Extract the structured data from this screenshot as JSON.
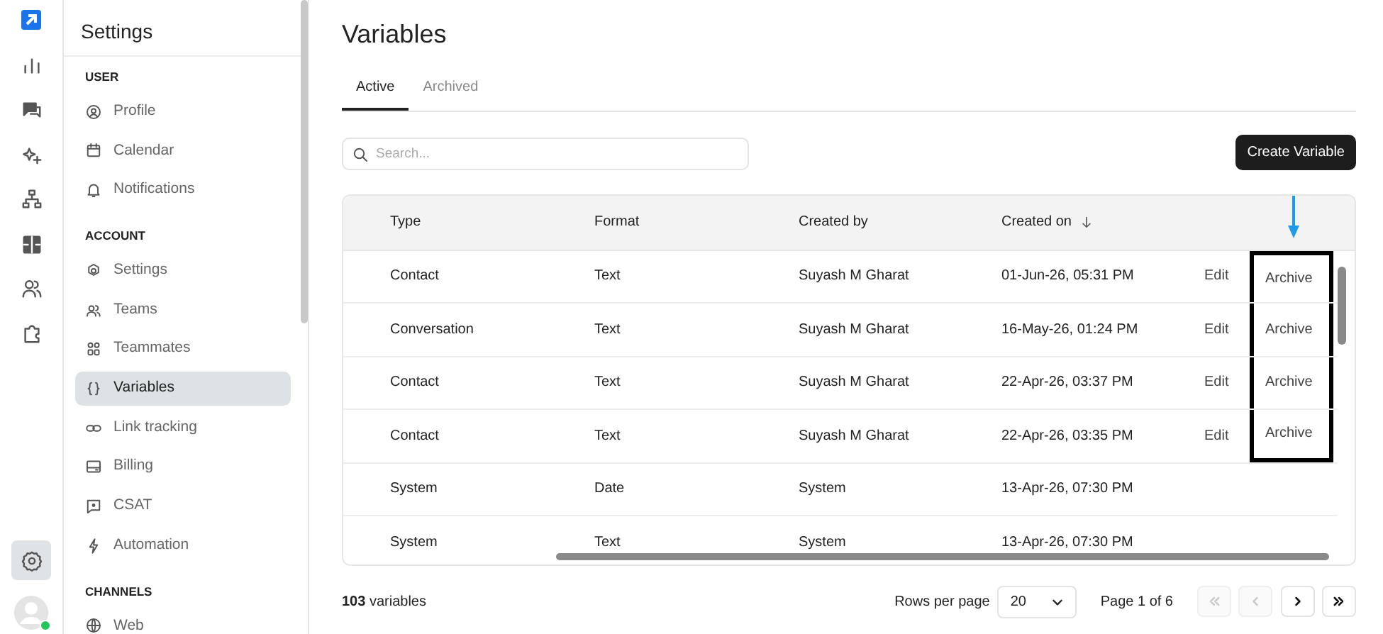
{
  "rail": {
    "items": [
      {
        "selected": false
      },
      {
        "selected": false
      },
      {
        "selected": false
      },
      {
        "selected": false
      },
      {
        "selected": false
      },
      {
        "selected": false
      },
      {
        "selected": false
      }
    ],
    "settings_selected": true,
    "user_online": true
  },
  "sidebar": {
    "title": "Settings",
    "sections": [
      {
        "heading": "USER",
        "items": [
          {
            "label": "Profile",
            "selected": false
          },
          {
            "label": "Calendar",
            "selected": false
          },
          {
            "label": "Notifications",
            "selected": false
          }
        ]
      },
      {
        "heading": "ACCOUNT",
        "items": [
          {
            "label": "Settings",
            "selected": false
          },
          {
            "label": "Teams",
            "selected": false
          },
          {
            "label": "Teammates",
            "selected": false
          },
          {
            "label": "Variables",
            "selected": true
          },
          {
            "label": "Link tracking",
            "selected": false
          },
          {
            "label": "Billing",
            "selected": false
          },
          {
            "label": "CSAT",
            "selected": false
          },
          {
            "label": "Automation",
            "selected": false
          }
        ]
      },
      {
        "heading": "CHANNELS",
        "items": [
          {
            "label": "Web",
            "selected": false
          }
        ]
      }
    ]
  },
  "page": {
    "title": "Variables",
    "tabs": [
      {
        "label": "Active",
        "selected": true
      },
      {
        "label": "Archived",
        "selected": false
      }
    ],
    "search": {
      "placeholder": "Search..."
    },
    "create_button": "Create Variable",
    "table": {
      "columns": [
        {
          "label": "Type",
          "sorted": false
        },
        {
          "label": "Format",
          "sorted": false
        },
        {
          "label": "Created by",
          "sorted": false
        },
        {
          "label": "Created on",
          "sorted": true
        }
      ],
      "rows": [
        {
          "type": "Contact",
          "format": "Text",
          "created_by": "Suyash M Gharat",
          "created_on": "01-Jun-26, 05:31 PM",
          "actions": [
            "Edit",
            "Archive"
          ],
          "highlighted": true
        },
        {
          "type": "Conversation",
          "format": "Text",
          "created_by": "Suyash M Gharat",
          "created_on": "16-May-26, 01:24 PM",
          "actions": [
            "Edit",
            "Archive"
          ],
          "highlighted": true
        },
        {
          "type": "Contact",
          "format": "Text",
          "created_by": "Suyash M Gharat",
          "created_on": "22-Apr-26, 03:37 PM",
          "actions": [
            "Edit",
            "Archive"
          ],
          "highlighted": true
        },
        {
          "type": "Contact",
          "format": "Text",
          "created_by": "Suyash M Gharat",
          "created_on": "22-Apr-26, 03:35 PM",
          "actions": [
            "Edit",
            "Archive"
          ],
          "highlighted": true
        },
        {
          "type": "System",
          "format": "Date",
          "created_by": "System",
          "created_on": "13-Apr-26, 07:30 PM",
          "actions": [],
          "highlighted": false
        },
        {
          "type": "System",
          "format": "Text",
          "created_by": "System",
          "created_on": "13-Apr-26, 07:30 PM",
          "actions": [],
          "highlighted": false
        }
      ]
    },
    "footer": {
      "count": "**103** variables",
      "rows_per_page_label": "Rows per page",
      "rows_per_page": "20",
      "page_info": "Page 1 of 6",
      "pager": [
        {
          "disabled": true
        },
        {
          "disabled": true
        },
        {
          "disabled": false
        },
        {
          "disabled": false
        }
      ]
    }
  }
}
